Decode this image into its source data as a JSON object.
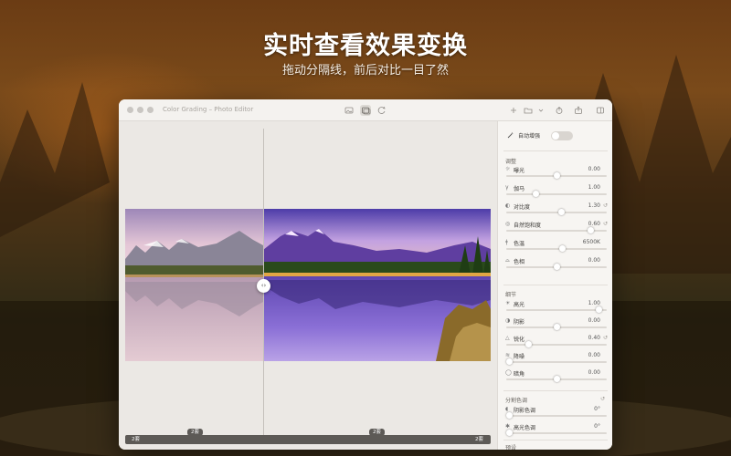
{
  "hero": {
    "title": "实时查看效果变换",
    "subtitle": "拖动分隔线，前后对比一目了然"
  },
  "window": {
    "title": "Color Grading – Photo Editor",
    "toolbar_center": [
      "image-icon",
      "compare-icon",
      "rotate-icon"
    ],
    "toolbar_right": [
      "plus-icon",
      "folder-icon",
      "chevron-down-icon",
      "export-icon",
      "share-icon",
      "sidebar-icon"
    ]
  },
  "canvas": {
    "zoom_left": "2套",
    "zoom_mid": "2套",
    "bottom_left": "2套",
    "bottom_right": "2套"
  },
  "panel": {
    "auto_enhance": {
      "label": "自动增强",
      "on": false
    },
    "adjust": {
      "title": "调整",
      "rows": [
        {
          "icon": "exposure-icon",
          "label": "曝光",
          "value": "0.00",
          "level": 0.5,
          "reset": false
        },
        {
          "icon": "gamma-icon",
          "label": "伽马",
          "value": "1.00",
          "level": 0.28,
          "reset": false
        },
        {
          "icon": "contrast-icon",
          "label": "对比度",
          "value": "1.30",
          "level": 0.55,
          "reset": true
        },
        {
          "icon": "saturation-icon",
          "label": "自然饱和度",
          "value": "0.60",
          "level": 0.86,
          "reset": true
        },
        {
          "icon": "thermometer-icon",
          "label": "色温",
          "value": "6500K",
          "level": 0.56,
          "reset": false
        },
        {
          "icon": "tint-icon",
          "label": "色相",
          "value": "0.00",
          "level": 0.5,
          "reset": false
        }
      ]
    },
    "detail": {
      "title": "细节",
      "reset": true,
      "rows": [
        {
          "icon": "highlights-icon",
          "label": "高光",
          "value": "1.00",
          "level": 0.95,
          "reset": false
        },
        {
          "icon": "shadows-icon",
          "label": "阴影",
          "value": "0.00",
          "level": 0.5,
          "reset": false
        },
        {
          "icon": "sharpen-icon",
          "label": "锐化",
          "value": "0.40",
          "level": 0.2,
          "reset": true
        },
        {
          "icon": "noise-icon",
          "label": "降噪",
          "value": "0.00",
          "level": 0.0,
          "reset": false
        },
        {
          "icon": "vignette-icon",
          "label": "暗角",
          "value": "0.00",
          "level": 0.5,
          "reset": false
        }
      ]
    },
    "split_tone": {
      "title": "分割色调",
      "reset": true,
      "rows": [
        {
          "icon": "shadow-tone-icon",
          "label": "阴影色调",
          "value": "0°"
        },
        {
          "icon": "highlight-tone-icon",
          "label": "高光色调",
          "value": "0°"
        }
      ]
    },
    "preset": {
      "title": "预设"
    }
  },
  "colors": {
    "window_bg": "#efece8",
    "panel_bg": "#f7f5f2",
    "track": "#dcd8d3"
  }
}
